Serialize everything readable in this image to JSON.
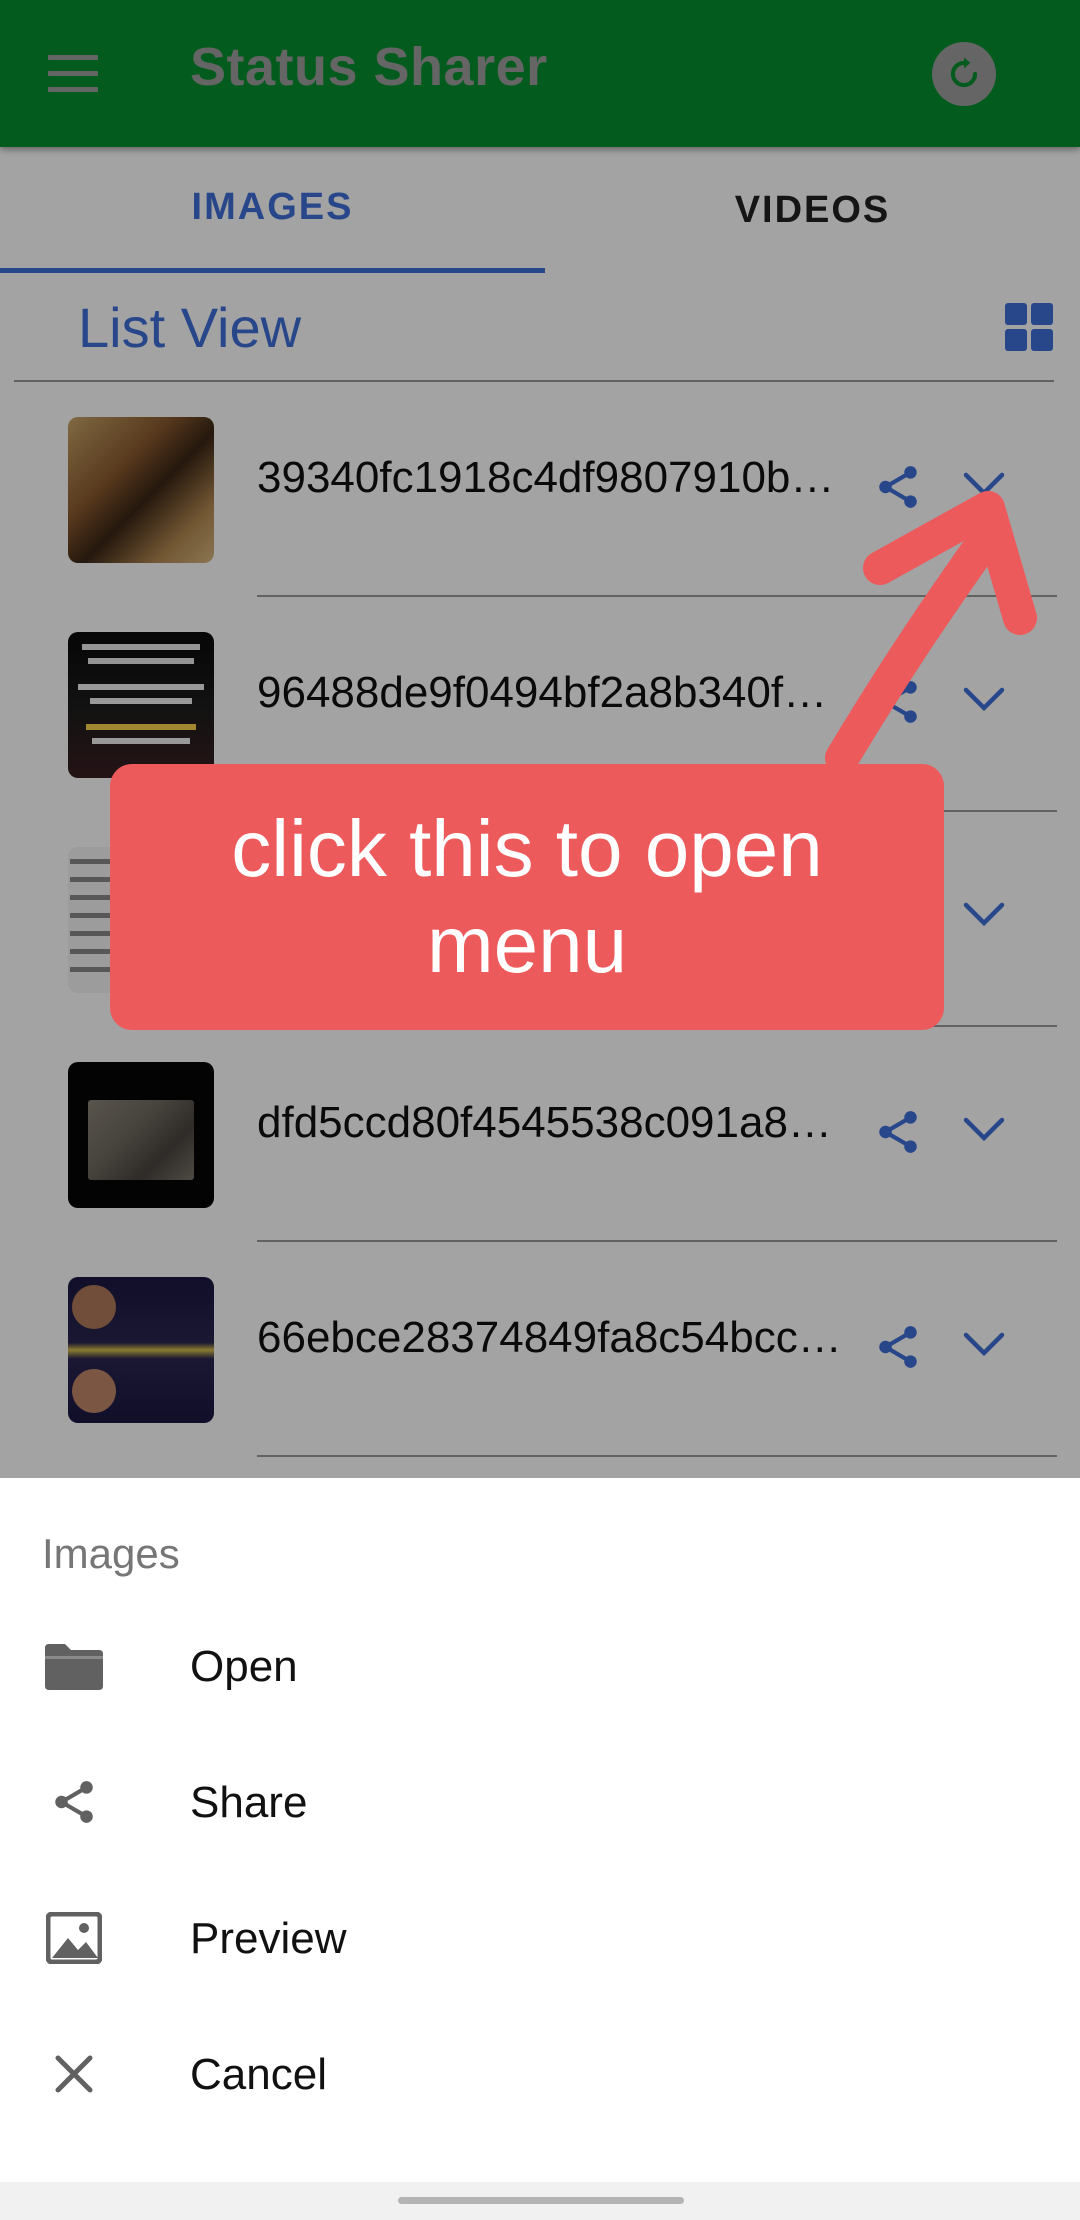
{
  "app": {
    "title": "Status Sharer",
    "colors": {
      "appbar": "#06902f",
      "accent": "#3f6fd8",
      "callout": "#ec5a5c"
    }
  },
  "toolbar": {
    "menu_icon": "hamburger-icon",
    "refresh_icon": "refresh-icon"
  },
  "tabs": [
    {
      "label": "IMAGES",
      "selected": true
    },
    {
      "label": "VIDEOS",
      "selected": false
    }
  ],
  "view": {
    "title": "List View",
    "toggle_icon": "grid-view-icon"
  },
  "files": [
    {
      "name": "39340fc1918c4df9807910b…"
    },
    {
      "name": "96488de9f0494bf2a8b340f…"
    },
    {
      "name": ""
    },
    {
      "name": "dfd5ccd80f4545538c091a8…"
    },
    {
      "name": "66ebce28374849fa8c54bcc…"
    }
  ],
  "callout": {
    "line1": "click this to open",
    "line2": "menu"
  },
  "sheet": {
    "title": "Images",
    "items": [
      {
        "label": "Open",
        "icon": "folder-icon"
      },
      {
        "label": "Share",
        "icon": "share-icon"
      },
      {
        "label": "Preview",
        "icon": "image-icon"
      },
      {
        "label": "Cancel",
        "icon": "close-icon"
      }
    ]
  }
}
